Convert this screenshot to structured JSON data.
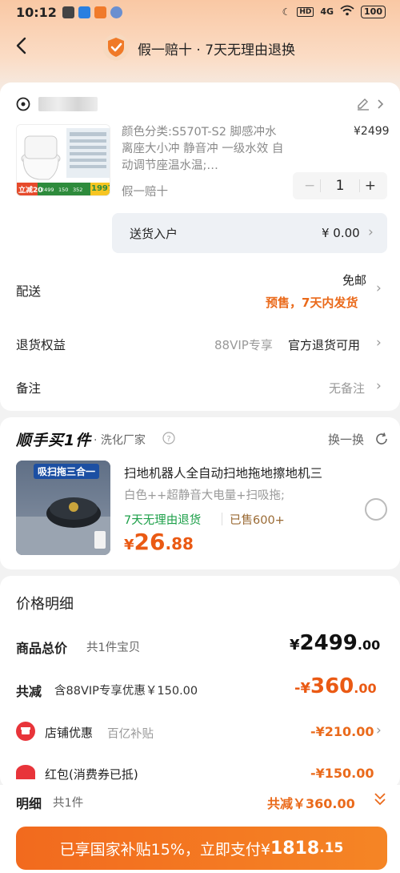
{
  "status_bar": {
    "time": "10:12",
    "battery": "100",
    "network": "4G"
  },
  "nav": {
    "title": "假一赔十 · 7天无理由退换"
  },
  "order": {
    "product_desc": "颜色分类:S570T-S2 脚感冲水 离座大小冲 静音冲 一级水效 自动调节座温水温;…",
    "product_price": "¥2499",
    "product_tag": "假一赔十",
    "quantity": "1",
    "minus": "−",
    "plus": "+",
    "delivery_label": "送货入户",
    "delivery_price": "¥ 0.00",
    "rows": {
      "shipping_label": "配送",
      "shipping_free": "免邮",
      "shipping_note": "预售，7天内发货",
      "refund_label": "退货权益",
      "refund_vip": "88VIP专享",
      "refund_value": "官方退货可用",
      "remark_label": "备注",
      "remark_value": "无备注"
    },
    "image_text": {
      "banner": "立减20",
      "price": "1997",
      "cells": [
        "2499",
        "150",
        "352"
      ]
    }
  },
  "combo": {
    "title": "顺手买1件",
    "subtitle": "· 洗化厂家",
    "swap": "换一换",
    "robot": {
      "badge": "吸扫拖三合一",
      "title": "扫地机器人全自动扫地拖地擦地机三",
      "spec": "白色++超静音大电量+扫吸拖;",
      "return_policy": "7天无理由退货",
      "sold": "已售600+",
      "price_symbol": "¥",
      "price_int": "26",
      "price_dec": ".88"
    }
  },
  "price_detail": {
    "title": "价格明细",
    "total_label": "商品总价",
    "total_sub": "共1件宝贝",
    "total_symbol": "¥",
    "total_int": "2499",
    "total_dec": ".00",
    "discount_label": "共减",
    "discount_sub": "含88VIP专享优惠￥150.00",
    "discount_symbol": "-¥",
    "discount_int": "360",
    "discount_dec": ".00",
    "store_label": "店铺优惠",
    "store_sub": "百亿补贴",
    "store_value": "-¥210.00",
    "redpack_label": "红包(消费券已抵)",
    "redpack_value": "-¥150.00"
  },
  "bottom": {
    "detail_label": "明细",
    "detail_sub": "共1件",
    "detail_saving": "共减￥360.00",
    "pay_prefix": "已享国家补贴15%，立即支付¥",
    "pay_int": "1818",
    "pay_dec": ".15"
  },
  "colors": {
    "accent": "#ea6a1b",
    "pay_button": "#f26a1e",
    "green": "#1ea04a"
  }
}
